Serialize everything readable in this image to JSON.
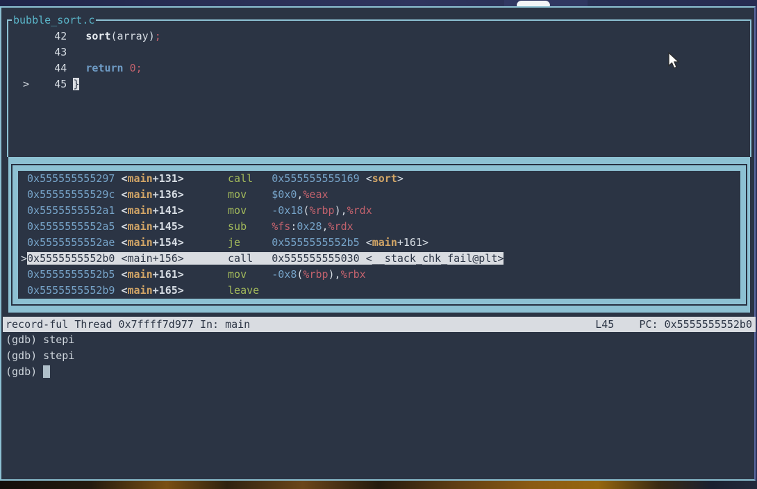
{
  "source_window": {
    "title": "bubble_sort.c",
    "lines": [
      {
        "marker": " ",
        "number": "42",
        "code": [
          [
            "  ",
            "pl"
          ],
          [
            "sort",
            "fnw"
          ],
          [
            "(",
            "pl"
          ],
          [
            "array",
            "pl"
          ],
          [
            ")",
            "pl"
          ],
          [
            ";",
            "reg"
          ]
        ]
      },
      {
        "marker": " ",
        "number": "43",
        "code": []
      },
      {
        "marker": " ",
        "number": "44",
        "code": [
          [
            "  ",
            "pl"
          ],
          [
            "return",
            "kw"
          ],
          [
            " ",
            "pl"
          ],
          [
            "0;",
            "reg"
          ]
        ]
      },
      {
        "marker": ">",
        "number": "45",
        "code": [
          [
            "}",
            "cur"
          ]
        ]
      }
    ]
  },
  "asm_window": {
    "rows": [
      {
        "current": false,
        "addr": "0x555555555297",
        "func": [
          [
            "<",
            "pl"
          ],
          [
            "main",
            "fn"
          ],
          [
            "+131>",
            "pl"
          ]
        ],
        "mnemonic": "call",
        "operands": [
          [
            "0x555555555169",
            "num"
          ],
          [
            " <",
            "pl"
          ],
          [
            "sort",
            "fn"
          ],
          [
            ">",
            "pl"
          ]
        ]
      },
      {
        "current": false,
        "addr": "0x55555555529c",
        "func": [
          [
            "<",
            "pl"
          ],
          [
            "main",
            "fn"
          ],
          [
            "+136>",
            "pl"
          ]
        ],
        "mnemonic": "mov",
        "operands": [
          [
            "$0x0",
            "num"
          ],
          [
            ",",
            "pl"
          ],
          [
            "%eax",
            "reg"
          ]
        ]
      },
      {
        "current": false,
        "addr": "0x5555555552a1",
        "func": [
          [
            "<",
            "pl"
          ],
          [
            "main",
            "fn"
          ],
          [
            "+141>",
            "pl"
          ]
        ],
        "mnemonic": "mov",
        "operands": [
          [
            "-0x18",
            "num"
          ],
          [
            "(",
            "pl"
          ],
          [
            "%rbp",
            "reg"
          ],
          [
            "),",
            "pl"
          ],
          [
            "%rdx",
            "reg"
          ]
        ]
      },
      {
        "current": false,
        "addr": "0x5555555552a5",
        "func": [
          [
            "<",
            "pl"
          ],
          [
            "main",
            "fn"
          ],
          [
            "+145>",
            "pl"
          ]
        ],
        "mnemonic": "sub",
        "operands": [
          [
            "%fs",
            "reg"
          ],
          [
            ":",
            "pl"
          ],
          [
            "0x28",
            "num"
          ],
          [
            ",",
            "pl"
          ],
          [
            "%rdx",
            "reg"
          ]
        ]
      },
      {
        "current": false,
        "addr": "0x5555555552ae",
        "func": [
          [
            "<",
            "pl"
          ],
          [
            "main",
            "fn"
          ],
          [
            "+154>",
            "pl"
          ]
        ],
        "mnemonic": "je",
        "operands": [
          [
            "0x5555555552b5",
            "num"
          ],
          [
            " <",
            "pl"
          ],
          [
            "main",
            "fn"
          ],
          [
            "+161>",
            "pl"
          ]
        ]
      },
      {
        "current": true,
        "addr": "0x5555555552b0",
        "func": [
          [
            "<",
            "pl"
          ],
          [
            "main",
            "fn"
          ],
          [
            "+156>",
            "pl"
          ]
        ],
        "mnemonic": "call",
        "operands": [
          [
            "0x555555555030",
            "num"
          ],
          [
            " <",
            "pl"
          ],
          [
            "__stack_chk_fail@plt",
            "fn"
          ],
          [
            ">",
            "pl"
          ]
        ]
      },
      {
        "current": false,
        "addr": "0x5555555552b5",
        "func": [
          [
            "<",
            "pl"
          ],
          [
            "main",
            "fn"
          ],
          [
            "+161>",
            "pl"
          ]
        ],
        "mnemonic": "mov",
        "operands": [
          [
            "-0x8",
            "num"
          ],
          [
            "(",
            "pl"
          ],
          [
            "%rbp",
            "reg"
          ],
          [
            "),",
            "pl"
          ],
          [
            "%rbx",
            "reg"
          ]
        ]
      },
      {
        "current": false,
        "addr": "0x5555555552b9",
        "func": [
          [
            "<",
            "pl"
          ],
          [
            "main",
            "fn"
          ],
          [
            "+165>",
            "pl"
          ]
        ],
        "mnemonic": "leave",
        "operands": []
      }
    ]
  },
  "status_bar": {
    "left": "record-ful Thread 0x7ffff7d977 In: main",
    "right": "L45    PC: 0x5555555552b0"
  },
  "console": {
    "history": [
      "(gdb) stepi",
      "(gdb) stepi"
    ],
    "prompt": "(gdb)"
  },
  "colors": {
    "terminal_bg": "#2b3444",
    "focus_border": "#8dc1d3",
    "highlight_bg": "#d9dce1",
    "address_blue": "#76a3c8",
    "symbol_yellow": "#d2a566",
    "mnemonic_green": "#a3ba5b",
    "register_red": "#c2626d",
    "title_cyan": "#5ab5c9"
  }
}
